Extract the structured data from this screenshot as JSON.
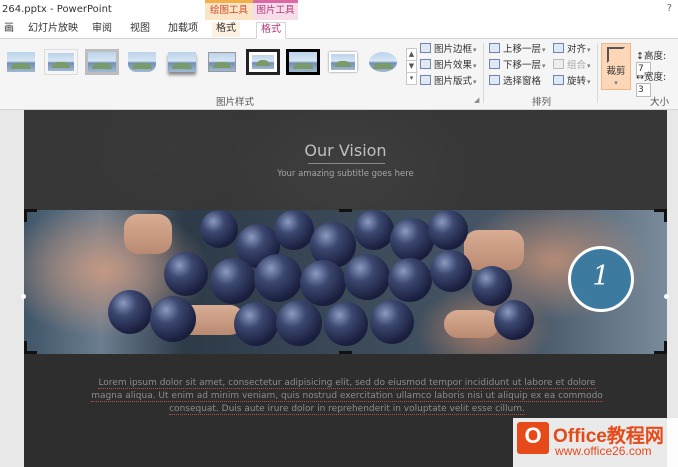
{
  "window": {
    "title": "264.pptx - PowerPoint",
    "help": "?"
  },
  "context_tabs": {
    "drawing_tools": "绘图工具",
    "picture_tools": "图片工具"
  },
  "tabs": [
    "画",
    "幻灯片放映",
    "审阅",
    "视图",
    "加载项",
    "格式",
    "格式"
  ],
  "active_tab_index": 6,
  "ribbon": {
    "picture_styles_label": "图片样式",
    "picture_border": "图片边框",
    "picture_effects": "图片效果",
    "picture_layout": "图片版式",
    "bring_forward": "上移一层",
    "send_backward": "下移一层",
    "selection_pane": "选择窗格",
    "align": "对齐",
    "group": "组合",
    "rotate": "旋转",
    "arrange_label": "排列",
    "crop": "裁剪",
    "height_label": "高度:",
    "height_value": "7",
    "width_label": "宽度:",
    "width_value": "3",
    "size_label": "大小",
    "accent_color": "#b4357a"
  },
  "slide": {
    "title": "Our Vision",
    "subtitle": "Your amazing subtitle goes here",
    "badge_number": "1",
    "body_text": "Lorem ipsum dolor sit amet, consectetur adipisicing elit, sed do eiusmod tempor incididunt ut labore et dolore magna aliqua. Ut enim ad minim veniam, quis nostrud exercitation ullamco laboris nisi ut aliquip ex ea commodo consequat. Duis aute irure dolor in reprehenderit in voluptate velit esse cillum.",
    "badge_color": "#3d7aa0"
  },
  "watermark": {
    "logo_letter": "O",
    "name": "Office教程网",
    "url": "www.office26.com",
    "color": "#e64a19"
  }
}
